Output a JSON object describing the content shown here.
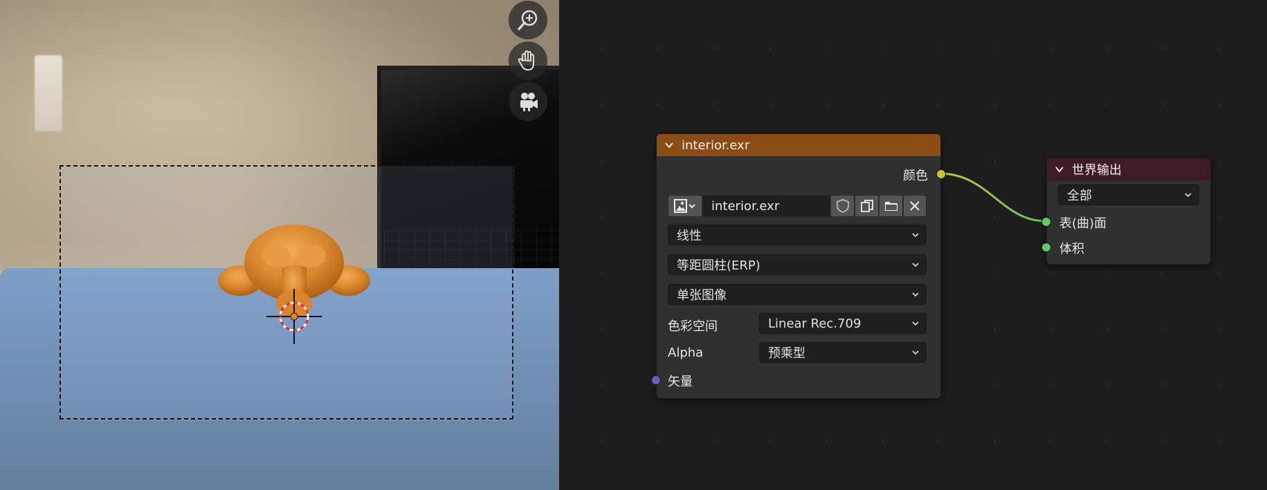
{
  "viewport": {
    "tools": [
      {
        "icon": "zoom-in-icon"
      },
      {
        "icon": "hand-pan-icon"
      },
      {
        "icon": "camera-view-icon"
      }
    ],
    "scene_object": "monkey-head",
    "floor_color": "#7f9fc7"
  },
  "image_node": {
    "title": "interior.exr",
    "header_color": "#8a4b14",
    "output_color_label": "颜色",
    "image_name": "interior.exr",
    "interpolation": "线性",
    "projection": "等距圆柱(ERP)",
    "source": "单张图像",
    "colorspace_label": "色彩空间",
    "colorspace_value": "Linear Rec.709",
    "alpha_label": "Alpha",
    "alpha_value": "预乘型",
    "vector_label": "矢量",
    "socket_colors": {
      "color": "#c7c729",
      "vector": "#6363c7"
    }
  },
  "output_node": {
    "title": "世界输出",
    "header_color": "#3e1c27",
    "target": "全部",
    "surface_label": "表(曲)面",
    "volume_label": "体积",
    "socket_color": "#63c763"
  }
}
